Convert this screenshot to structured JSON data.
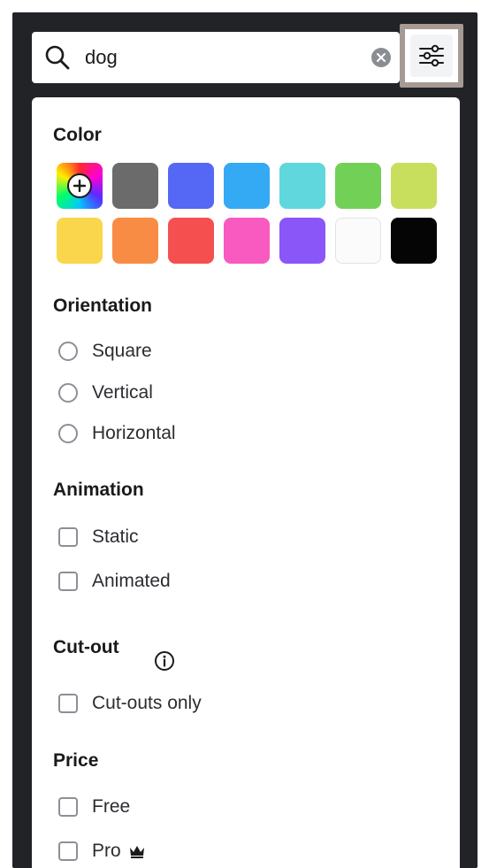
{
  "search": {
    "value": "dog",
    "clear_icon": "clear-circle-icon",
    "search_icon": "magnifier-icon",
    "filter_icon": "sliders-icon"
  },
  "color": {
    "title": "Color",
    "swatches": [
      {
        "name": "add-custom",
        "hex": "conic"
      },
      {
        "name": "gray",
        "hex": "#6b6b6b"
      },
      {
        "name": "blue",
        "hex": "#5468f5"
      },
      {
        "name": "sky-blue",
        "hex": "#34aaf5"
      },
      {
        "name": "turquoise",
        "hex": "#5fd7dc"
      },
      {
        "name": "green",
        "hex": "#72d057"
      },
      {
        "name": "lime",
        "hex": "#c8df5e"
      },
      {
        "name": "yellow",
        "hex": "#f9d64b"
      },
      {
        "name": "orange",
        "hex": "#f98c45"
      },
      {
        "name": "red",
        "hex": "#f5504f"
      },
      {
        "name": "pink",
        "hex": "#f85ac0"
      },
      {
        "name": "purple",
        "hex": "#8a56f8"
      },
      {
        "name": "white",
        "hex": "#fbfbfb"
      },
      {
        "name": "black",
        "hex": "#050505"
      }
    ]
  },
  "orientation": {
    "title": "Orientation",
    "options": [
      "Square",
      "Vertical",
      "Horizontal"
    ]
  },
  "animation": {
    "title": "Animation",
    "options": [
      "Static",
      "Animated"
    ]
  },
  "cutout": {
    "title": "Cut-out",
    "options": [
      "Cut-outs only"
    ]
  },
  "price": {
    "title": "Price",
    "options": [
      "Free",
      "Pro"
    ]
  }
}
